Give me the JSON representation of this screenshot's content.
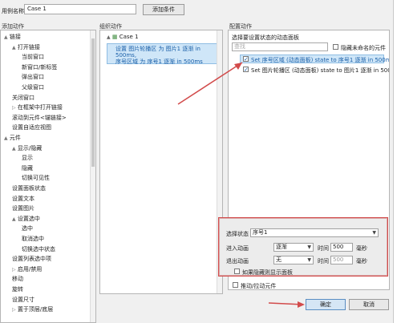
{
  "header": {
    "case_name_label": "用例名称",
    "case_name_value": "Case 1",
    "add_condition": "添加条件"
  },
  "sections": {
    "add_action": "添加动作",
    "organize_action": "组织动作",
    "config_action": "配置动作"
  },
  "tree": [
    {
      "label": "链接",
      "level": 0,
      "expand": "▲"
    },
    {
      "label": "打开链接",
      "level": 1,
      "expand": "▲"
    },
    {
      "label": "当前窗口",
      "level": 2
    },
    {
      "label": "新窗口/新标签",
      "level": 2
    },
    {
      "label": "弹出窗口",
      "level": 2
    },
    {
      "label": "父级窗口",
      "level": 2
    },
    {
      "label": "关闭窗口",
      "level": 1
    },
    {
      "label": "在框架中打开链接",
      "level": 1,
      "expand": "▷"
    },
    {
      "label": "滚动到元件<锚链接>",
      "level": 1
    },
    {
      "label": "设置自适应视图",
      "level": 1
    },
    {
      "label": "元件",
      "level": 0,
      "expand": "▲"
    },
    {
      "label": "显示/隐藏",
      "level": 1,
      "expand": "▲"
    },
    {
      "label": "显示",
      "level": 2
    },
    {
      "label": "隐藏",
      "level": 2
    },
    {
      "label": "切换可见性",
      "level": 2
    },
    {
      "label": "设置面板状态",
      "level": 1
    },
    {
      "label": "设置文本",
      "level": 1
    },
    {
      "label": "设置图片",
      "level": 1
    },
    {
      "label": "设置选中",
      "level": 1,
      "expand": "▲"
    },
    {
      "label": "选中",
      "level": 2
    },
    {
      "label": "取消选中",
      "level": 2
    },
    {
      "label": "切换选中状态",
      "level": 2
    },
    {
      "label": "设置列表选中项",
      "level": 1
    },
    {
      "label": "启用/禁用",
      "level": 1,
      "expand": "▷"
    },
    {
      "label": "移动",
      "level": 1
    },
    {
      "label": "旋转",
      "level": 1
    },
    {
      "label": "设置尺寸",
      "level": 1
    },
    {
      "label": "置于顶层/底层",
      "level": 1,
      "expand": "▷"
    }
  ],
  "organize": {
    "case_node": "Case 1",
    "action_line1": "设置 图片轮播区 为 图片1 逐渐 in 500ms,",
    "action_line2": "序号区域 为 序号1 逐渐 in 500ms"
  },
  "config": {
    "panel_title": "选择要设置状态的动态面板",
    "filter_placeholder": "查找",
    "hide_unnamed": "隐藏未命名的元件",
    "rows": [
      {
        "text": "Set 序号区域 (动态面板) state to 序号1 逐渐 in 500ms",
        "checked": "✓"
      },
      {
        "text": "Set 图片轮播区 (动态面板) state to 图片1 逐渐 in 500ms",
        "checked": "✓"
      }
    ],
    "select_state_label": "选择状态",
    "select_state_value": "序号1",
    "enter_anim_label": "进入动画",
    "enter_anim_value": "逐渐",
    "exit_anim_label": "退出动画",
    "exit_anim_value": "无",
    "time_label": "时间",
    "enter_time": "500",
    "exit_time": "500",
    "ms_label": "毫秒",
    "show_if_hidden": "如果隐藏则显示面板",
    "push_pull": "推动/拉动元件"
  },
  "footer": {
    "ok": "确定",
    "cancel": "取消"
  },
  "colors": {
    "selection": "#cfe6f8",
    "annotation": "#d24b4b"
  }
}
